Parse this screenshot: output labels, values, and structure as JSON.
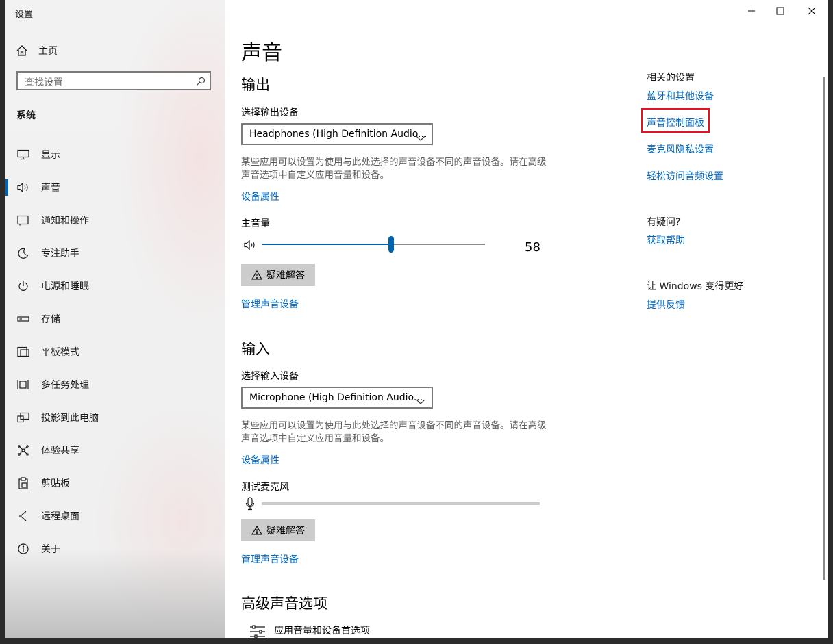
{
  "window": {
    "title": "设置"
  },
  "sidebar": {
    "home_label": "主页",
    "search_placeholder": "查找设置",
    "section_title": "系统",
    "items": [
      {
        "label": "显示",
        "icon": "monitor-icon"
      },
      {
        "label": "声音",
        "icon": "speaker-icon",
        "selected": true
      },
      {
        "label": "通知和操作",
        "icon": "notification-icon"
      },
      {
        "label": "专注助手",
        "icon": "moon-icon"
      },
      {
        "label": "电源和睡眠",
        "icon": "power-icon"
      },
      {
        "label": "存储",
        "icon": "storage-icon"
      },
      {
        "label": "平板模式",
        "icon": "tablet-icon"
      },
      {
        "label": "多任务处理",
        "icon": "multitask-icon"
      },
      {
        "label": "投影到此电脑",
        "icon": "projection-icon"
      },
      {
        "label": "体验共享",
        "icon": "share-icon"
      },
      {
        "label": "剪贴板",
        "icon": "clipboard-icon"
      },
      {
        "label": "远程桌面",
        "icon": "remote-desktop-icon"
      },
      {
        "label": "关于",
        "icon": "info-icon"
      }
    ]
  },
  "main": {
    "page_title": "声音",
    "output": {
      "heading": "输出",
      "device_label": "选择输出设备",
      "device_value": "Headphones (High Definition Audio...",
      "description": "某些应用可以设置为使用与此处选择的声音设备不同的声音设备。请在高级声音选项中自定义应用音量和设备。",
      "properties_link": "设备属性",
      "volume_label": "主音量",
      "volume_value": "58",
      "volume_level": 58,
      "troubleshoot_label": "疑难解答",
      "manage_link": "管理声音设备"
    },
    "input": {
      "heading": "输入",
      "device_label": "选择输入设备",
      "device_value": "Microphone (High Definition Audio...",
      "description": "某些应用可以设置为使用与此处选择的声音设备不同的声音设备。请在高级声音选项中自定义应用音量和设备。",
      "properties_link": "设备属性",
      "test_label": "测试麦克风",
      "mic_level": 0,
      "troubleshoot_label": "疑难解答",
      "manage_link": "管理声音设备"
    },
    "advanced": {
      "heading": "高级声音选项",
      "app_volume_label": "应用音量和设备首选项"
    }
  },
  "related": {
    "heading": "相关的设置",
    "links": [
      "蓝牙和其他设备",
      "声音控制面板",
      "麦克风隐私设置",
      "轻松访问音频设置"
    ],
    "highlighted_link": "声音控制面板",
    "highlight_color": "#e81123"
  },
  "help": {
    "heading": "有疑问?",
    "link": "获取帮助"
  },
  "feedback": {
    "heading": "让 Windows 变得更好",
    "link": "提供反馈"
  },
  "colors": {
    "accent": "#0067c0",
    "slider_accent": "#0063b1",
    "button_gray": "#cccccc"
  }
}
